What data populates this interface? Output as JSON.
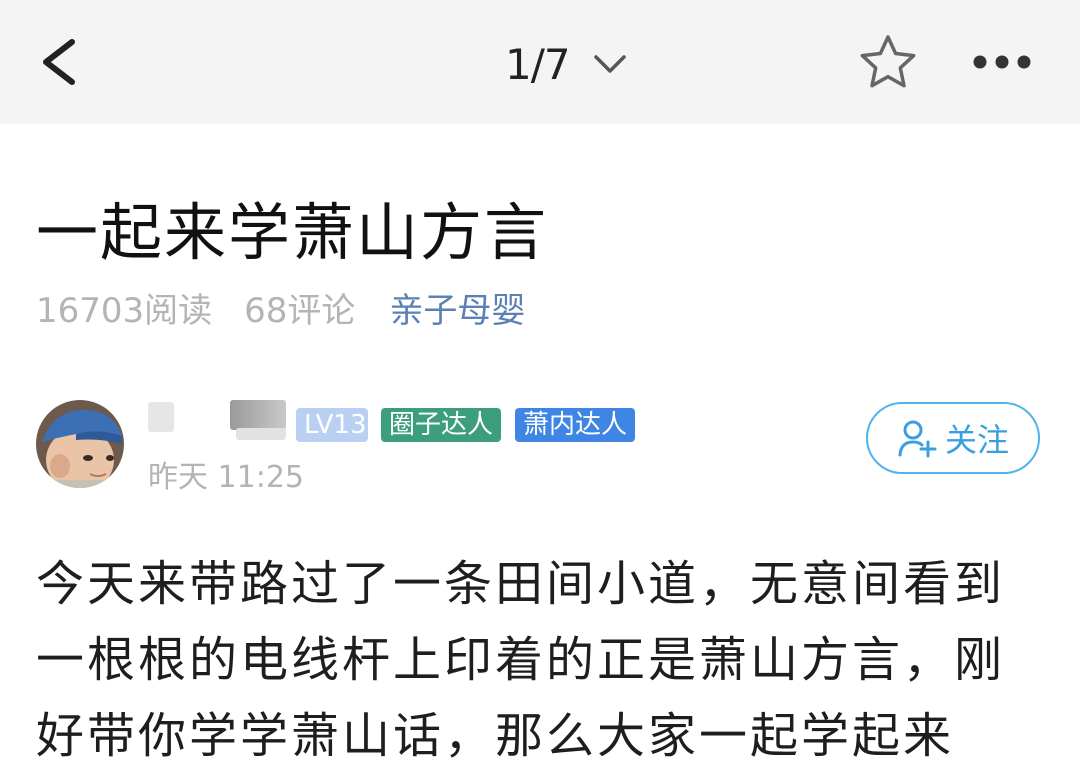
{
  "header": {
    "back_icon": "chevron-left-icon",
    "page_indicator": "1/7",
    "dropdown_icon": "chevron-down-icon",
    "favorite_icon": "star-outline-icon",
    "more_icon": "more-dots-icon"
  },
  "article": {
    "title": "一起来学萧山方言",
    "reads": "16703阅读",
    "comments": "68评论",
    "category": "亲子母婴"
  },
  "author": {
    "level_badge": "LV13",
    "badges": [
      "圈子达人",
      "萧内达人"
    ],
    "post_time": "昨天 11:25",
    "follow_label": "关注",
    "follow_icon": "add-user-icon"
  },
  "content": {
    "paragraph": "今天来带路过了一条田间小道，无意间看到一根根的电线杆上印着的正是萧山方言，刚好带你学学萧山话，那么大家一起学起来"
  },
  "colors": {
    "topbar_bg": "#f4f4f4",
    "category_link": "#5a80b4",
    "muted_text": "#b4b4b4",
    "level_badge_bg": "#b9d0f3",
    "badge_green": "#3d9e7d",
    "badge_blue": "#3f86e4",
    "follow_accent": "#4fb4ee"
  }
}
